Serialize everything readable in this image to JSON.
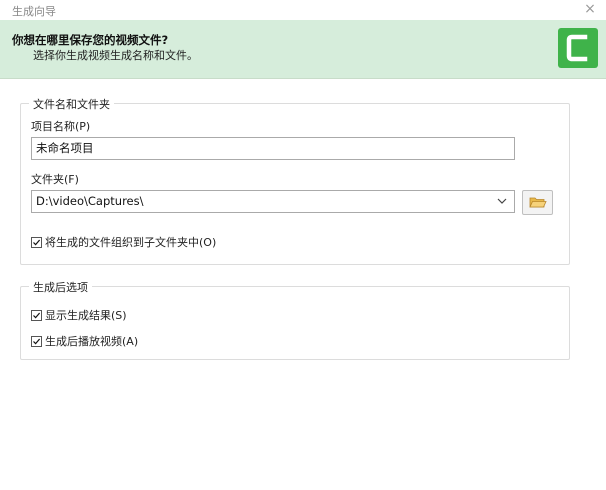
{
  "window": {
    "title": "生成向导",
    "close_label": "×"
  },
  "banner": {
    "heading": "你想在哪里保存您的视频文件?",
    "subheading": "选择你生成视频生成名称和文件。"
  },
  "file_group": {
    "legend": "文件名和文件夹",
    "project_name_label": "项目名称(P)",
    "project_name_value": "未命名项目",
    "folder_label": "文件夹(F)",
    "folder_value": "D:\\video\\Captures\\",
    "organize_checkbox_label": "将生成的文件组织到子文件夹中(O)",
    "organize_checked": true
  },
  "post_group": {
    "legend": "生成后选项",
    "show_results_label": "显示生成结果(S)",
    "show_results_checked": true,
    "play_video_label": "生成后播放视频(A)",
    "play_video_checked": true
  },
  "colors": {
    "banner_bg": "#d6eddb",
    "logo_green": "#3fb34a"
  },
  "icons": {
    "close": "close-icon",
    "logo": "camtasia-logo-icon",
    "folder": "folder-icon",
    "dropdown": "chevron-down-icon",
    "check": "check-icon"
  }
}
